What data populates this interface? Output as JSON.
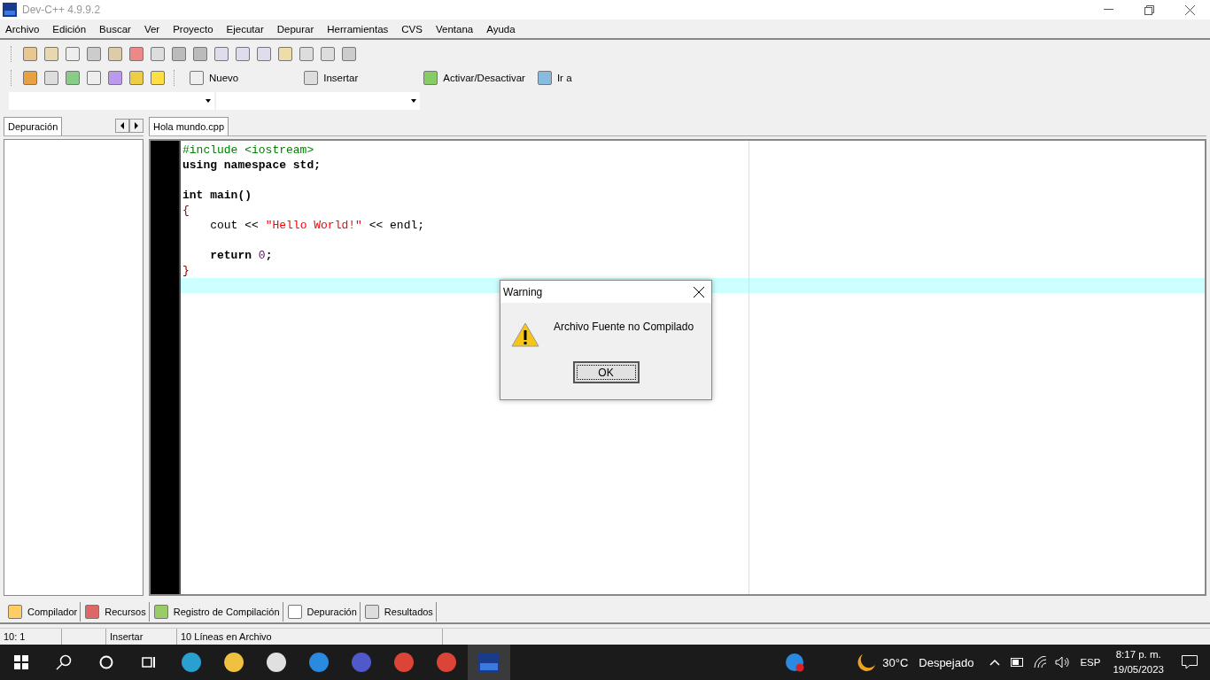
{
  "window": {
    "title": "Dev-C++ 4.9.9.2"
  },
  "menu": [
    "Archivo",
    "Edición",
    "Buscar",
    "Ver",
    "Proyecto",
    "Ejecutar",
    "Depurar",
    "Herramientas",
    "CVS",
    "Ventana",
    "Ayuda"
  ],
  "toolbar_buttons": [
    "Nuevo",
    "Insertar",
    "Activar/Desactivar",
    "Ir a"
  ],
  "left_panel": {
    "tabs": [
      {
        "label": "Depuración",
        "selected": true
      }
    ]
  },
  "editor": {
    "tabs": [
      {
        "label": "Hola mundo.cpp",
        "selected": true
      }
    ],
    "lines": [
      {
        "selected": false,
        "tokens": [
          {
            "text": "#include <iostream>",
            "kind": "pre"
          }
        ]
      },
      {
        "selected": false,
        "tokens": [
          {
            "text": "using namespace std;",
            "kind": "kw"
          }
        ]
      },
      {
        "selected": false
      },
      {
        "selected": false,
        "tokens": [
          {
            "text": "int main()",
            "kind": "kw"
          }
        ]
      },
      {
        "selected": false,
        "tokens": [
          {
            "text": "{",
            "kind": "brace"
          }
        ]
      },
      {
        "selected": false,
        "tokens": [
          {
            "text": "    cout << ",
            "kind": "id"
          },
          {
            "text": "\"Hello World!\"",
            "kind": "str"
          },
          {
            "text": " << endl;",
            "kind": "id"
          }
        ]
      },
      {
        "selected": false
      },
      {
        "selected": false,
        "tokens": [
          {
            "text": "    return ",
            "kind": "kw"
          },
          {
            "text": "0",
            "kind": "num"
          },
          {
            "text": ";",
            "kind": "kw"
          }
        ]
      },
      {
        "selected": false,
        "tokens": [
          {
            "text": "}",
            "kind": "brace"
          }
        ]
      },
      {
        "selected": true
      }
    ]
  },
  "bottom_tabs": [
    {
      "label": "Compilador",
      "selected": false
    },
    {
      "label": "Recursos",
      "selected": false
    },
    {
      "label": "Registro de Compilación",
      "selected": false
    },
    {
      "label": "Depuración",
      "selected": false
    },
    {
      "label": "Resultados",
      "selected": false
    }
  ],
  "status_bar": {
    "position": "10: 1",
    "mode": "Insertar",
    "info": "10 Líneas en Archivo"
  },
  "dialog": {
    "title": "Warning",
    "message": "Archivo Fuente no Compilado",
    "button": "OK"
  },
  "taskbar": {
    "weather": "30°C",
    "weather_text": "Despejado",
    "language": "ESP",
    "time": "8:17 p. m.",
    "date": "19/05/2023"
  }
}
